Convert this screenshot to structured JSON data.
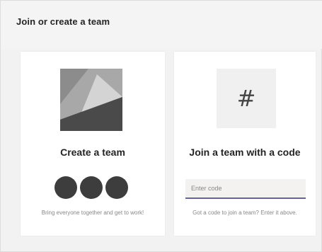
{
  "header": {
    "title": "Join or create a team"
  },
  "create_card": {
    "title": "Create a team",
    "description": "Bring everyone together and get to work!",
    "icon": "team-image-icon"
  },
  "join_card": {
    "icon_glyph": "#",
    "title": "Join a team with a code",
    "input_placeholder": "Enter code",
    "description": "Got a code to join a team? Enter it above."
  },
  "colors": {
    "background": "#f2f2f2",
    "card": "#ffffff",
    "accent": "#6264a7",
    "avatar": "#3d3d3d"
  }
}
